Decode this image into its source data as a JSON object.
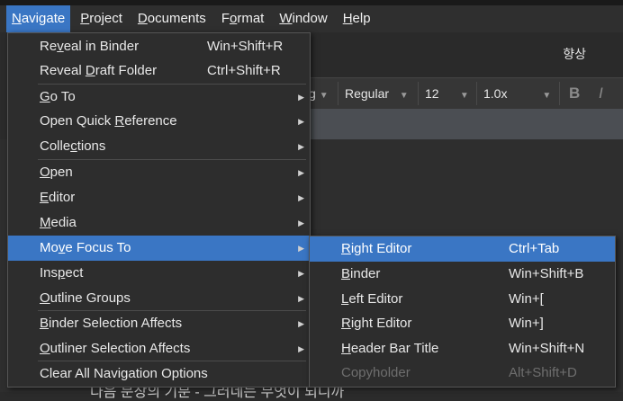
{
  "menubar": {
    "navigate": "Navigate",
    "project": "Project",
    "documents": "Documents",
    "format": "Format",
    "window": "Window",
    "help": "Help"
  },
  "header": {
    "title": "향상"
  },
  "formatbar": {
    "style": "Regular",
    "size": "12",
    "spacing": "1.0x",
    "bold": "B",
    "italic": "I",
    "font_partial": "g"
  },
  "editor": {
    "partial_text": "다음 문장의 기분 - 그러네는 무엇이 되니까"
  },
  "navigate_menu": {
    "items": [
      {
        "label": "Reveal in Binder",
        "shortcut": "Win+Shift+R"
      },
      {
        "label": "Reveal Draft Folder",
        "shortcut": "Ctrl+Shift+R"
      },
      {
        "label": "Go To"
      },
      {
        "label": "Open Quick Reference"
      },
      {
        "label": "Collections"
      },
      {
        "label": "Open"
      },
      {
        "label": "Editor"
      },
      {
        "label": "Media"
      },
      {
        "label": "Move Focus To"
      },
      {
        "label": "Inspect"
      },
      {
        "label": "Outline Groups"
      },
      {
        "label": "Binder Selection Affects"
      },
      {
        "label": "Outliner Selection Affects"
      },
      {
        "label": "Clear All Navigation Options"
      }
    ]
  },
  "move_focus_menu": {
    "items": [
      {
        "label": "Right Editor",
        "shortcut": "Ctrl+Tab"
      },
      {
        "label": "Binder",
        "shortcut": "Win+Shift+B"
      },
      {
        "label": "Left Editor",
        "shortcut": "Win+["
      },
      {
        "label": "Right Editor",
        "shortcut": "Win+]"
      },
      {
        "label": "Header Bar Title",
        "shortcut": "Win+Shift+N"
      },
      {
        "label": "Copyholder",
        "shortcut": "Alt+Shift+D"
      }
    ]
  },
  "colors": {
    "highlight": "#3a76c4",
    "menu_bg": "#2d2d2d",
    "menubar_bg": "#2f2f2f"
  }
}
